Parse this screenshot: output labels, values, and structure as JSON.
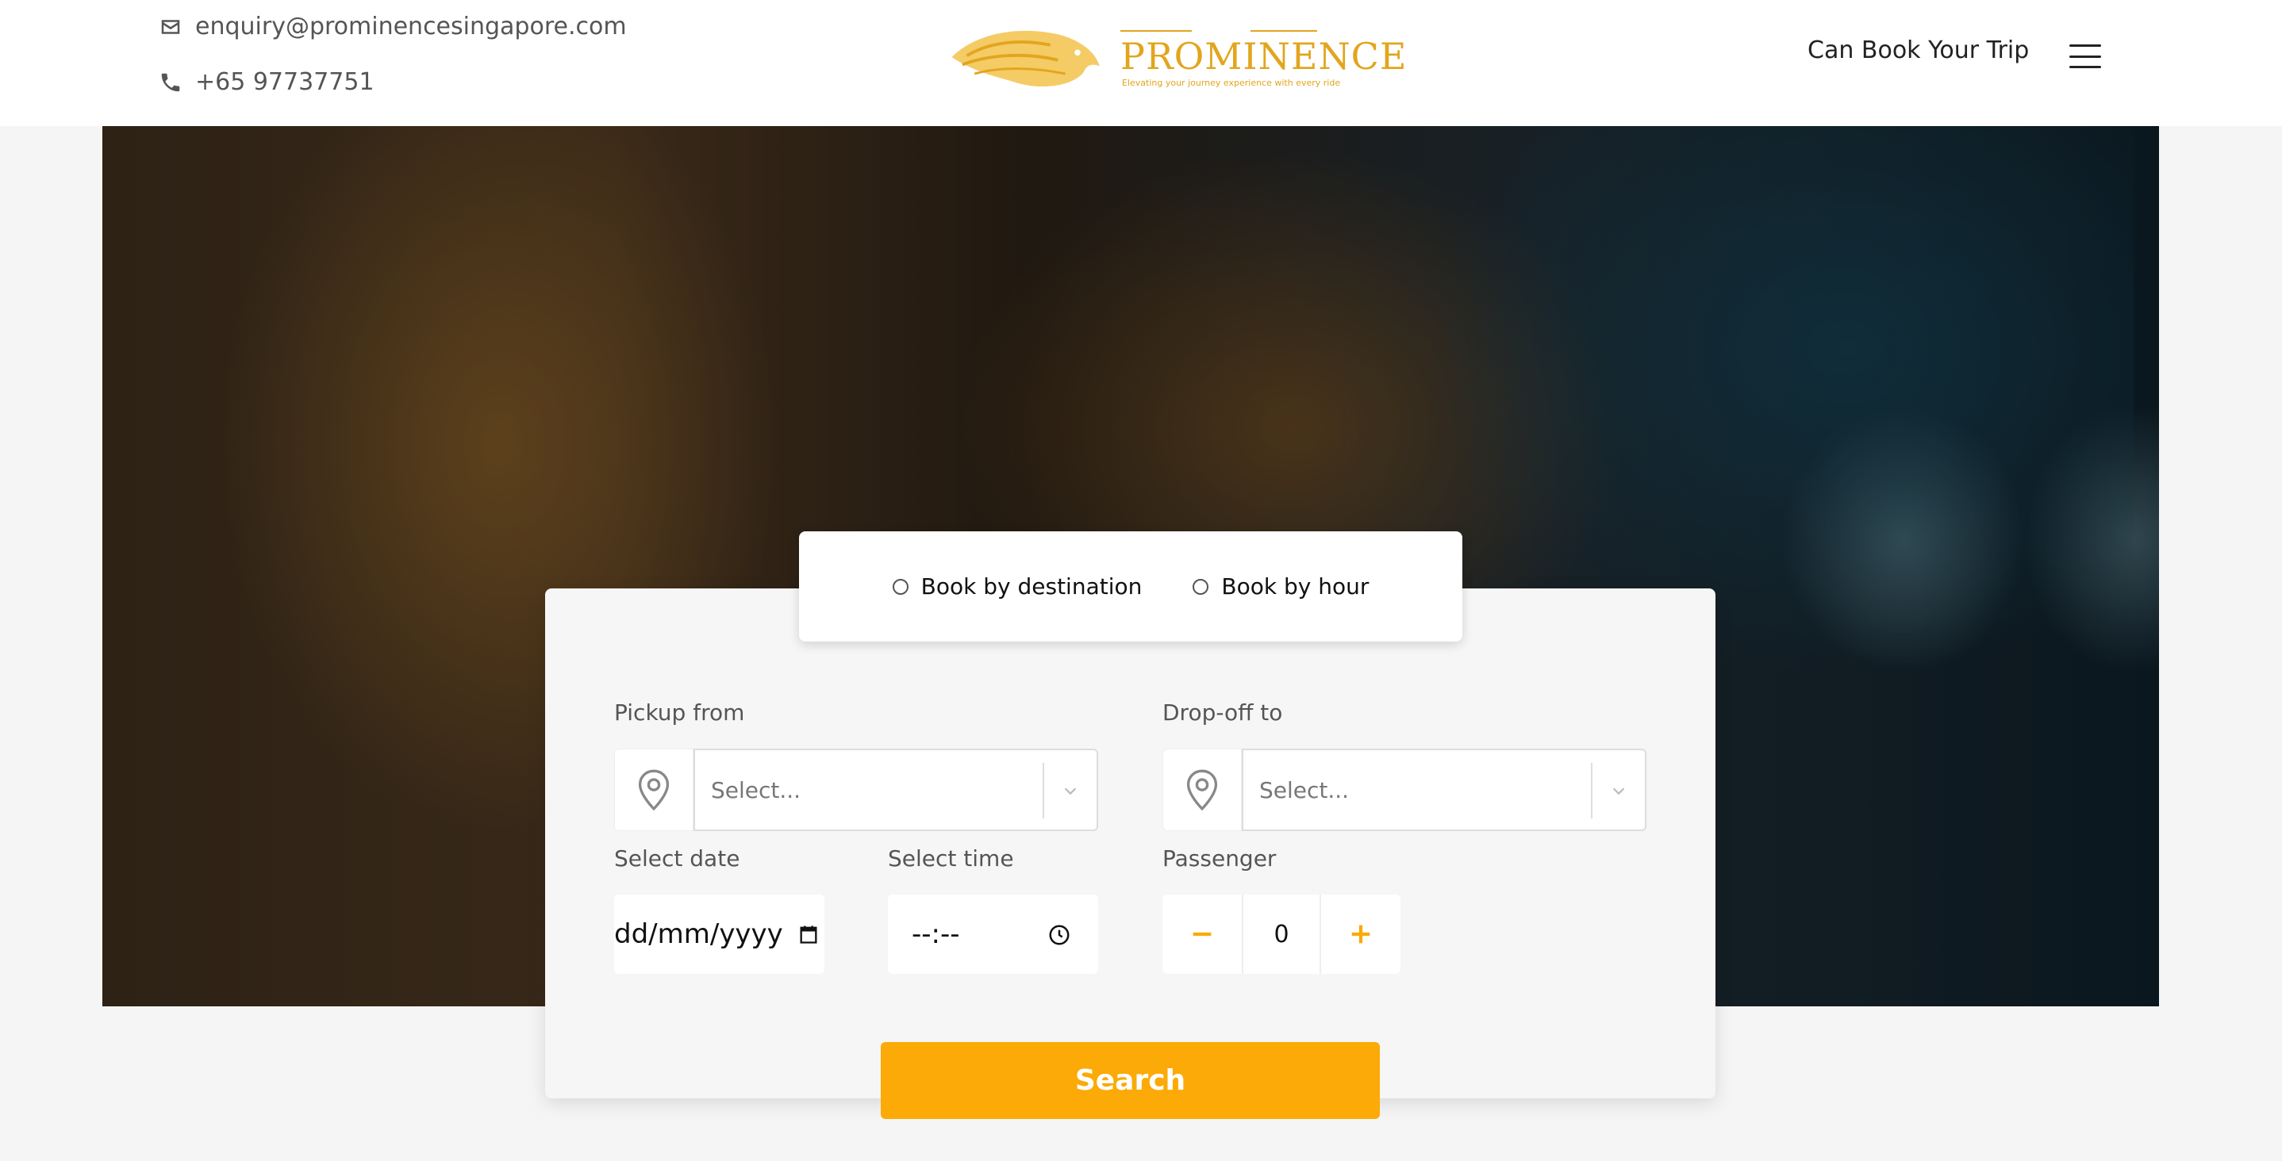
{
  "header": {
    "email": "enquiry@prominencesingapore.com",
    "phone": "+65 97737751",
    "logo": {
      "brand": "PROMINENCE",
      "tagline": "Elevating your journey experience with every ride"
    },
    "book_link": "Can Book Your Trip",
    "menu_icon": "hamburger-menu-icon"
  },
  "booking": {
    "modes": [
      {
        "label": "Book by destination",
        "selected": false
      },
      {
        "label": "Book by hour",
        "selected": false
      }
    ],
    "pickup": {
      "label": "Pickup from",
      "placeholder": "Select..."
    },
    "dropoff": {
      "label": "Drop-off to",
      "placeholder": "Select..."
    },
    "date": {
      "label": "Select date",
      "placeholder": "dd/mm/yyyy"
    },
    "time": {
      "label": "Select time",
      "placeholder": "--:--"
    },
    "passenger": {
      "label": "Passenger",
      "value": "0"
    },
    "search_label": "Search"
  },
  "colors": {
    "accent": "#fbaa07",
    "logo_gold": "#e2a51d"
  }
}
